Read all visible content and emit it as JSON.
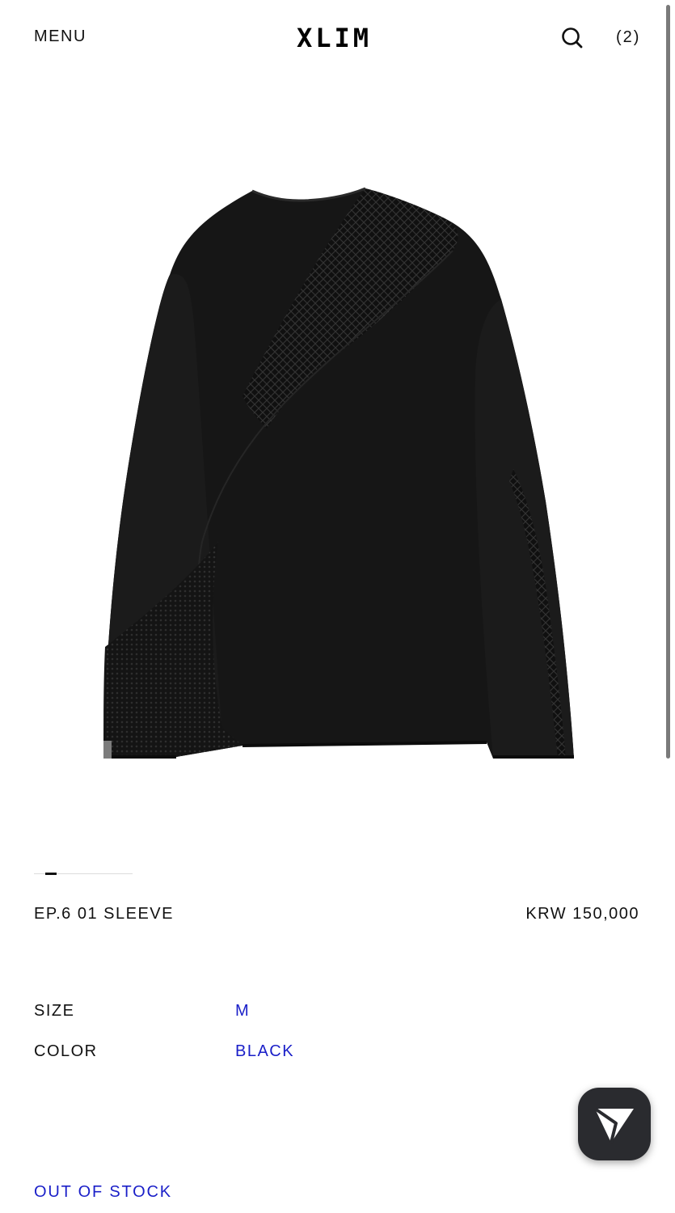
{
  "header": {
    "menu_label": "MENU",
    "logo": "XLIM",
    "cart_count": "(2)",
    "search_icon": "search-icon"
  },
  "product": {
    "image_icon": "long-sleeve-shirt",
    "name": "EP.6 01 SLEEVE",
    "price": "KRW 150,000",
    "options": {
      "size_label": "SIZE",
      "size_value": "M",
      "color_label": "COLOR",
      "color_value": "BLACK"
    },
    "stock_status": "OUT OF STOCK"
  },
  "carousel": {
    "current_slide": 1
  },
  "fab": {
    "icon": "send-icon"
  },
  "colors": {
    "accent": "#1a1fc8",
    "text": "#111111",
    "fab_bg": "#2a2b2f"
  }
}
